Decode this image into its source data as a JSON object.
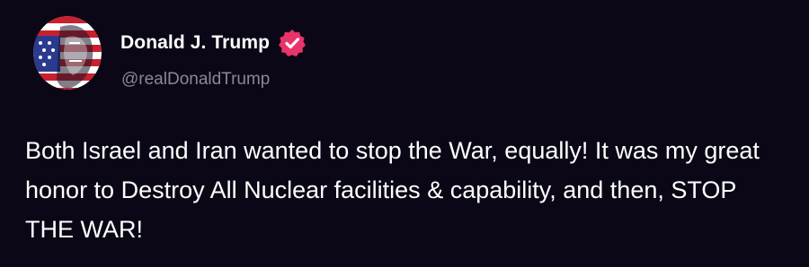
{
  "author": {
    "display_name": "Donald J. Trump",
    "handle": "@realDonaldTrump",
    "verified": true,
    "verified_badge_color": "#e8336b"
  },
  "post": {
    "text": "Both Israel and Iran wanted to stop the War, equally! It was my great honor to Destroy All Nuclear facilities & capability, and then, STOP THE WAR!"
  },
  "theme": {
    "background": "#0b0716",
    "text_primary": "#ffffff",
    "text_secondary": "#8a8799"
  }
}
